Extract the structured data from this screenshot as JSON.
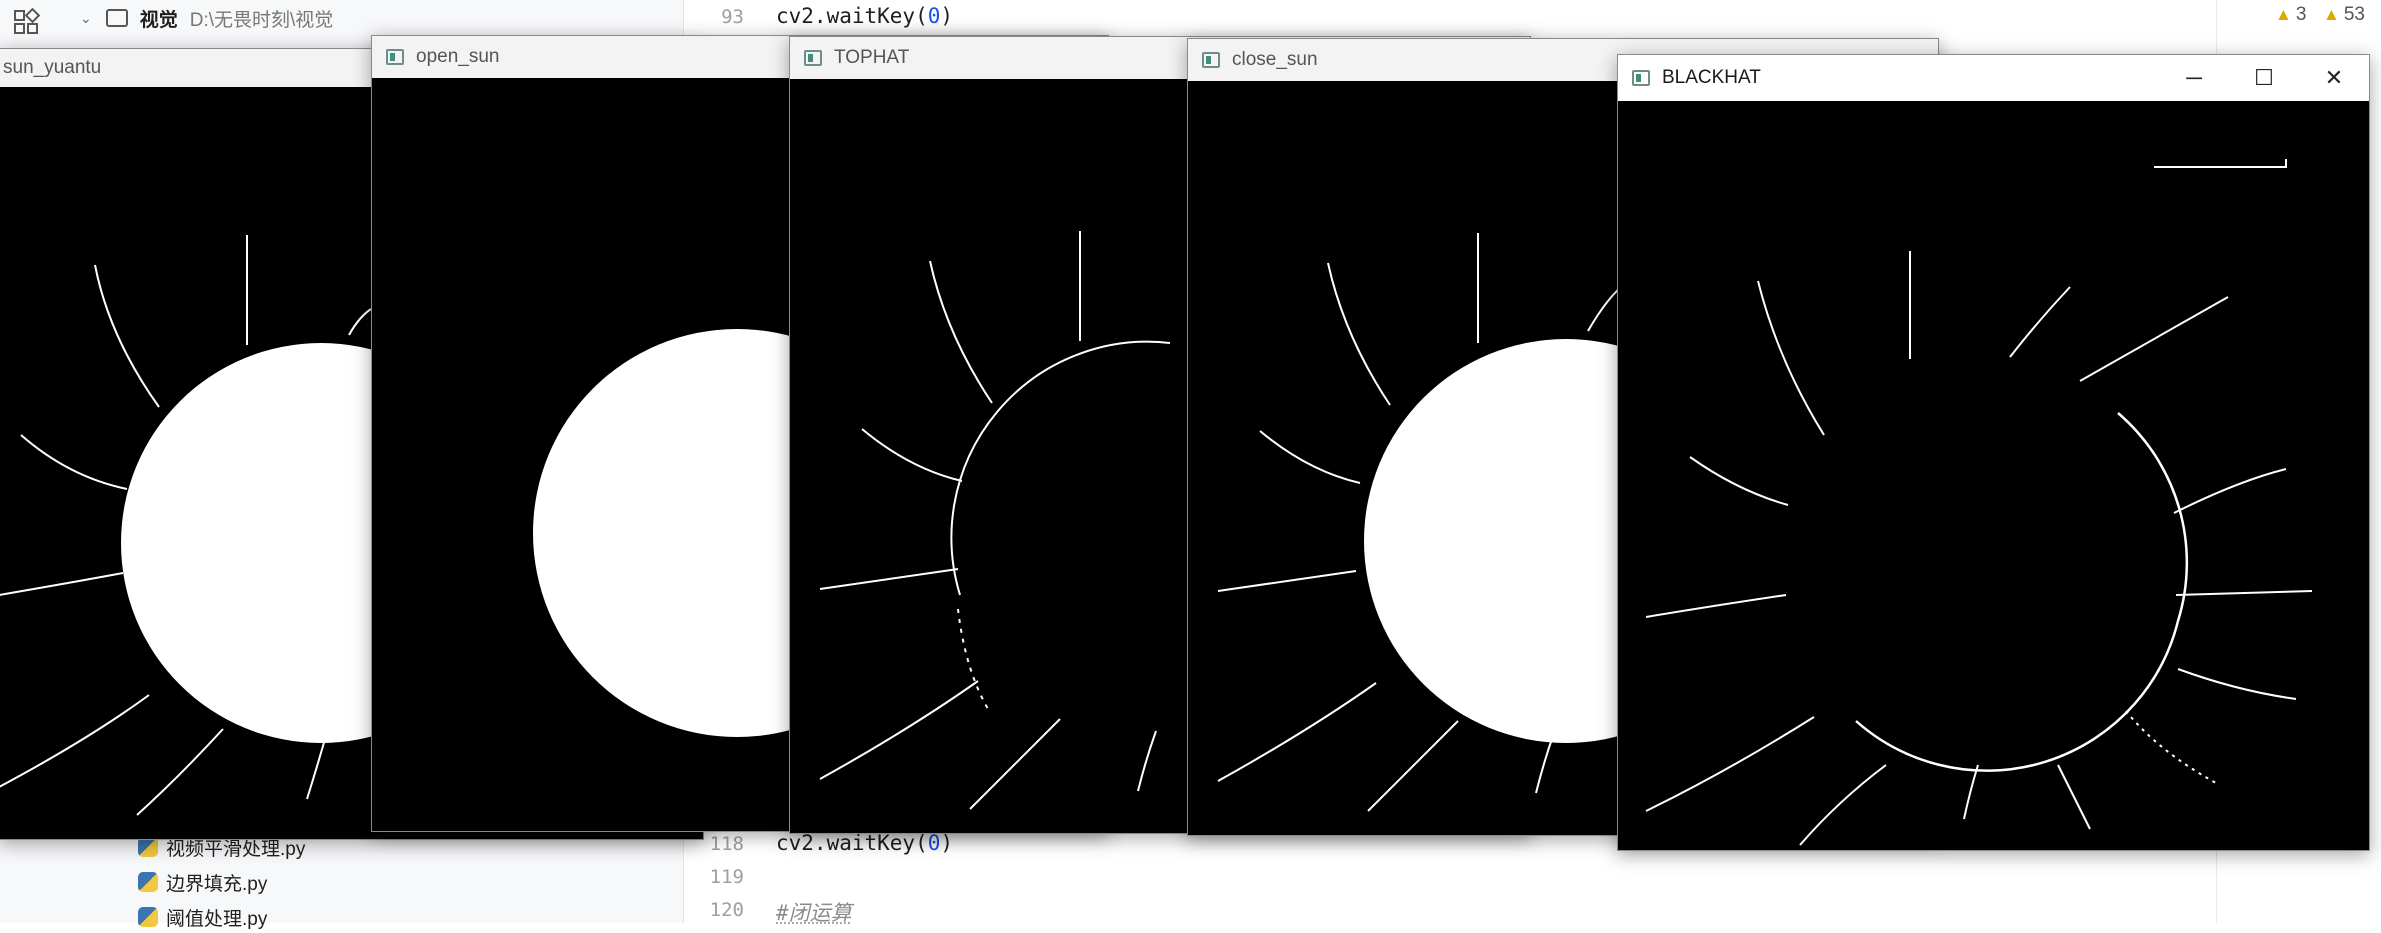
{
  "ide": {
    "project_tree": {
      "folder_name": "视觉",
      "folder_path": "D:\\无畏时刻\\视觉",
      "files": [
        "视频平滑处理.py",
        "边界填充.py",
        "阈值处理.py"
      ]
    },
    "editor": {
      "lines": [
        {
          "number": "93",
          "code": "cv2.waitKey(",
          "arg": "0",
          "close": ")"
        },
        {
          "number": "118",
          "code": "cv2.waitKey(",
          "arg": "0",
          "close": ")"
        },
        {
          "number": "119",
          "code": "",
          "arg": "",
          "close": ""
        },
        {
          "number": "120",
          "comment": "#闭运算"
        }
      ]
    },
    "inspections": {
      "warnings_a": "3",
      "warnings_b": "53"
    }
  },
  "windows": [
    {
      "id": "sun_yuantu",
      "title": "sun_yuantu",
      "variant": "original"
    },
    {
      "id": "open_sun",
      "title": "open_sun",
      "variant": "opened"
    },
    {
      "id": "tophat",
      "title": "TOPHAT",
      "variant": "tophat"
    },
    {
      "id": "close_sun",
      "title": "close_sun",
      "variant": "closed"
    },
    {
      "id": "blackhat",
      "title": "BLACKHAT",
      "variant": "blackhat",
      "controls": {
        "minimize": "─",
        "maximize": "☐",
        "close": "✕"
      }
    }
  ]
}
